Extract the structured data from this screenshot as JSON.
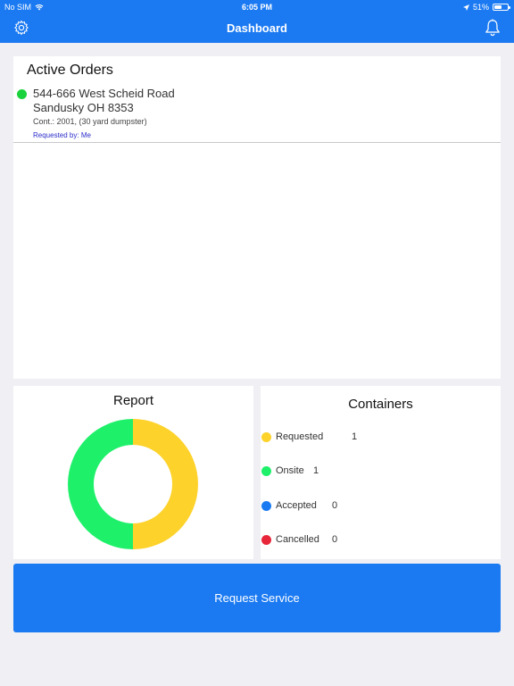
{
  "status_bar": {
    "carrier": "No SIM",
    "time": "6:05 PM",
    "battery": "51%"
  },
  "nav": {
    "title": "Dashboard",
    "left_icon": "gear-icon",
    "right_icon": "bell-icon"
  },
  "active_orders": {
    "title": "Active Orders",
    "items": [
      {
        "status_color": "#1ad33c",
        "address_line1": "544-666 West Scheid Road",
        "address_line2": "Sandusky OH 8353",
        "container": "Cont.: 2001, (30 yard dumpster)",
        "requested_by": "Requested by: Me"
      }
    ]
  },
  "report": {
    "title": "Report"
  },
  "containers": {
    "title": "Containers",
    "rows": [
      {
        "label": "Requested",
        "count": "1",
        "color": "#fdd22a"
      },
      {
        "label": "Onsite",
        "count": "1",
        "color": "#1ff06a"
      },
      {
        "label": "Accepted",
        "count": "0",
        "color": "#1b7af2"
      },
      {
        "label": "Cancelled",
        "count": "0",
        "color": "#e8263a"
      }
    ]
  },
  "chart_data": {
    "type": "pie",
    "categories": [
      "Requested",
      "Onsite",
      "Accepted",
      "Cancelled"
    ],
    "values": [
      1,
      1,
      0,
      0
    ],
    "colors": [
      "#fdd22a",
      "#1ff06a",
      "#1b7af2",
      "#e8263a"
    ],
    "donut": true
  },
  "request_button": {
    "label": "Request Service"
  },
  "colors": {
    "brand": "#1b7af2",
    "background": "#efeff4"
  }
}
